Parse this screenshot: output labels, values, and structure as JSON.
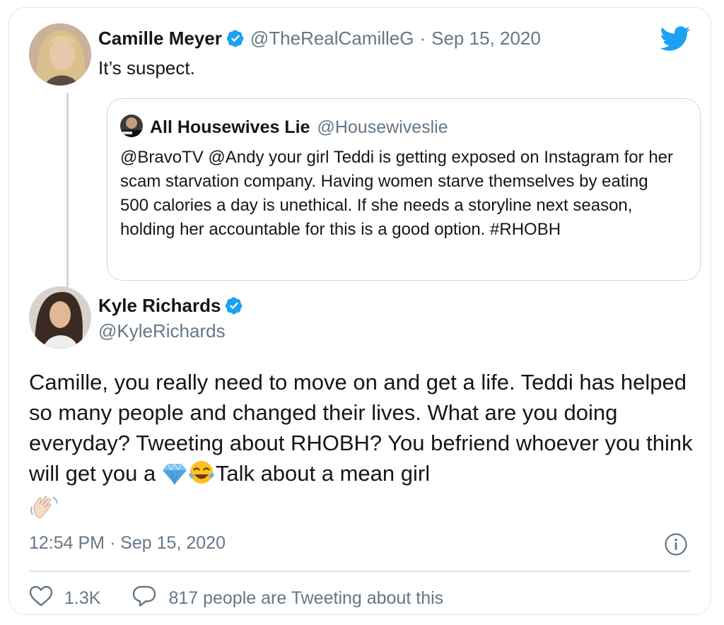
{
  "colors": {
    "twitter_blue": "#1da1f2",
    "secondary_text": "#657786",
    "border": "#dfe3e6"
  },
  "first_tweet": {
    "author_name": "Camille Meyer",
    "author_handle": "@TheRealCamilleG",
    "separator": "·",
    "date": "Sep 15, 2020",
    "text": "It’s suspect.",
    "verified": true
  },
  "quoted_tweet": {
    "author_name": "All Housewives Lie",
    "author_handle": "@Housewiveslie",
    "text": "@BravoTV @Andy your girl Teddi is getting exposed on Instagram for her scam starvation company. Having women starve themselves by eating 500 calories a day is unethical. If she needs a storyline next season, holding her accountable for this is a good option. #RHOBH"
  },
  "main_tweet": {
    "author_name": "Kyle Richards",
    "author_handle": "@KyleRichards",
    "verified": true,
    "text_before_emoji": "Camille, you really need to move on and get a life. Teddi has helped so many people and changed their lives. What are you doing everyday? Tweeting about RHOBH? You befriend whoever you think will get you a ",
    "text_after_emoji": "Talk about a mean girl",
    "emojis": [
      "gem-emoji",
      "tears-of-joy-emoji",
      "waving-hand-emoji"
    ],
    "timestamp": "12:54 PM · Sep 15, 2020"
  },
  "actions": {
    "likes": "1.3K",
    "replies_text": "817 people are Tweeting about this"
  },
  "icons": [
    "twitter-bird-icon",
    "verified-badge-icon",
    "info-icon",
    "heart-icon",
    "reply-bubble-icon"
  ]
}
